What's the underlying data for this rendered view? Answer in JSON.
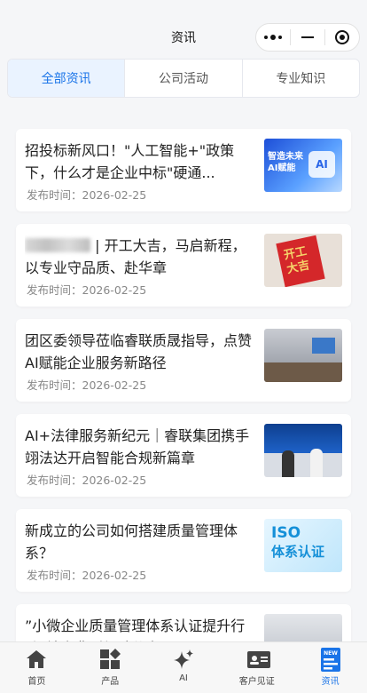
{
  "nav": {
    "title": "资讯"
  },
  "tabs": [
    {
      "label": "全部资讯",
      "active": true
    },
    {
      "label": "公司活动",
      "active": false
    },
    {
      "label": "专业知识",
      "active": false
    }
  ],
  "articles": [
    {
      "title": "招投标新风口！\"人工智能+\"政策下，什么才是企业中标\"硬通...",
      "date": "发布时间：2026-02-25",
      "thumb_text": "智造未来\nAI赋能",
      "thumb_badge": "AI"
    },
    {
      "title_blurred_prefix": true,
      "title": "| 开工大吉，马启新程，以专业守品质、赴华章",
      "date": "发布时间：2026-02-25",
      "thumb_text": "开工\n大吉"
    },
    {
      "title": "团区委领导莅临睿联质晟指导，点赞AI赋能企业服务新路径",
      "date": "发布时间：2026-02-25"
    },
    {
      "title": "AI+法律服务新纪元｜睿联集团携手翊法达开启智能合规新篇章",
      "date": "发布时间：2026-02-25"
    },
    {
      "title": "新成立的公司如何搭建质量管理体系？",
      "date": "发布时间：2026-02-25",
      "thumb_text": "ISO",
      "thumb_sub": "体系认证"
    },
    {
      "title": "”小微企业质量管理体系认证提升行动”地方典型经验分享",
      "date": ""
    }
  ],
  "tabbar": [
    {
      "label": "首页",
      "icon": "home-icon",
      "active": false
    },
    {
      "label": "产品",
      "icon": "grid-icon",
      "active": false
    },
    {
      "label": "AI",
      "icon": "sparkle-icon",
      "active": false
    },
    {
      "label": "客户见证",
      "icon": "id-card-icon",
      "active": false
    },
    {
      "label": "资讯",
      "icon": "news-icon",
      "badge": "NEW",
      "active": true
    }
  ],
  "colors": {
    "accent": "#1a74e8",
    "tab_active_bg": "#eaf3ff"
  }
}
